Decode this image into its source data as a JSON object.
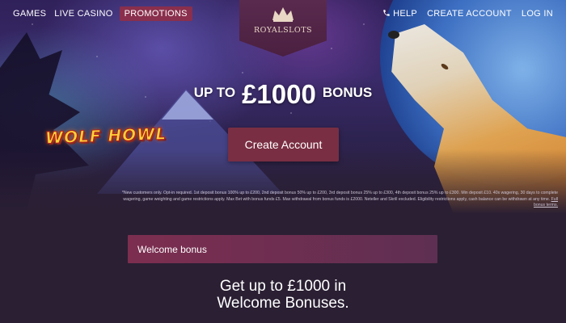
{
  "nav": {
    "left_links": [
      "GAMES",
      "LIVE CASINO",
      "PROMOTIONS"
    ],
    "active_link": "PROMOTIONS",
    "help": "HELP",
    "create_account": "CREATE ACCOUNT",
    "login": "LOG IN"
  },
  "logo": {
    "text": "ROYALSLOTS",
    "icon": "crown-icon"
  },
  "hero": {
    "headline_prefix": "UP TO",
    "headline_amount": "£1000",
    "headline_suffix": "BONUS",
    "game_logo_text": "WOLF HOWL",
    "cta_label": "Create Account"
  },
  "terms": {
    "text": "*New customers only. Opt-in required. 1st deposit bonus 100% up to £200, 2nd deposit bonus 50% up to £200, 3rd deposit bonus 25% up to £300, 4th deposit bonus 25% up to £300. Min deposit £10. 40x wagering, 30 days to complete wagering, game weighting and game restrictions apply. Max Bet with bonus funds £5. Max withdrawal from bonus funds is £2000. Neteller and Skrill excluded. Eligibility restrictions apply, cash balance can be withdrawn at any time.",
    "link": "Full bonus terms."
  },
  "welcome": {
    "label": "Welcome bonus"
  },
  "bottom": {
    "line1": "Get up to £1000 in",
    "line2": "Welcome Bonuses."
  },
  "colors": {
    "accent": "#7a2e43",
    "active_nav": "#8a2f4d",
    "background": "#2a1f33"
  }
}
